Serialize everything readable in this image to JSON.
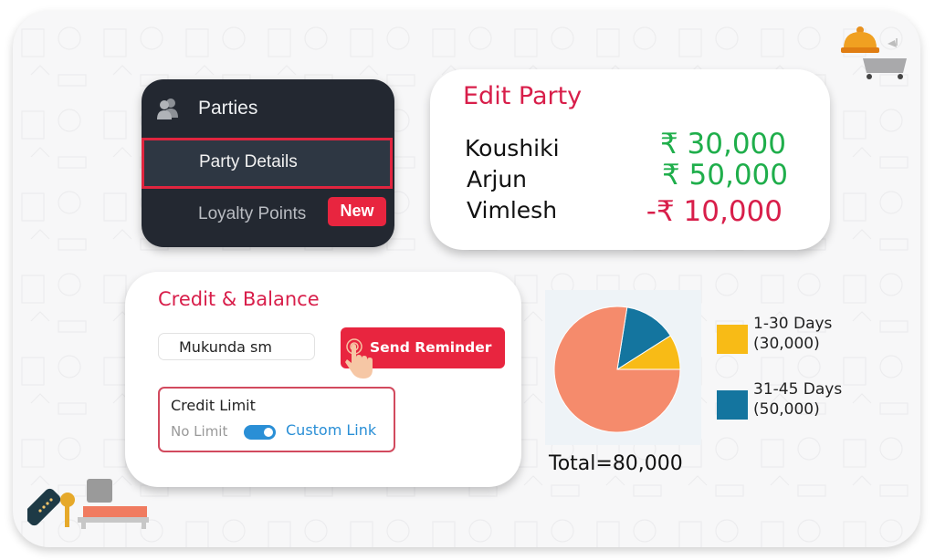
{
  "sidebar": {
    "section_label": "Parties",
    "section_icon": "users-icon",
    "items": [
      {
        "label": "Party Details",
        "active": true
      },
      {
        "label": "Loyalty Points",
        "badge": "New"
      }
    ]
  },
  "edit_party": {
    "title": "Edit Party",
    "rows": [
      {
        "name": "Koushiki",
        "amount": "₹ 30,000",
        "status": "positive"
      },
      {
        "name": "Arjun",
        "amount": "₹ 50,000",
        "status": "positive"
      },
      {
        "name": "Vimlesh",
        "amount": "-₹ 10,000",
        "status": "negative"
      }
    ]
  },
  "credit_balance": {
    "title": "Credit & Balance",
    "party_input_value": "Mukunda sm",
    "send_button_label": "Send Reminder",
    "credit_limit": {
      "title": "Credit Limit",
      "off_label": "No Limit",
      "on_label": "Custom Link",
      "toggle_on": true
    }
  },
  "chart_data": {
    "type": "pie",
    "title": "",
    "slices": [
      {
        "name": "1-30 Days",
        "label": "1-30 Days",
        "value_label": "(30,000)",
        "fraction": 0.09,
        "color": "#f8bb16"
      },
      {
        "name": "31-45 Days",
        "label": "31-45 Days",
        "value_label": "(50,000)",
        "fraction": 0.135,
        "color": "#14759f"
      },
      {
        "name": "Other",
        "label": "",
        "value_label": "",
        "fraction": 0.775,
        "color": "#f58b6c"
      }
    ],
    "legend": [
      {
        "line1": "1-30 Days",
        "line2": "(30,000)",
        "color": "#f8bb16"
      },
      {
        "line1": "31-45 Days",
        "line2": "(50,000)",
        "color": "#14759f"
      }
    ],
    "legend_position": "right",
    "total_label": "Total=80,000"
  },
  "colors": {
    "accent_red": "#e8253f",
    "title_red": "#d81e4a",
    "positive_green": "#1fae4b",
    "toggle_blue": "#2a8fd6",
    "sidebar_bg": "#232831"
  },
  "decorations": {
    "top_right": [
      "service-bell-icon",
      "bathtub-icon"
    ],
    "bottom_left": [
      "hotel-key-icon",
      "bed-icon"
    ]
  }
}
